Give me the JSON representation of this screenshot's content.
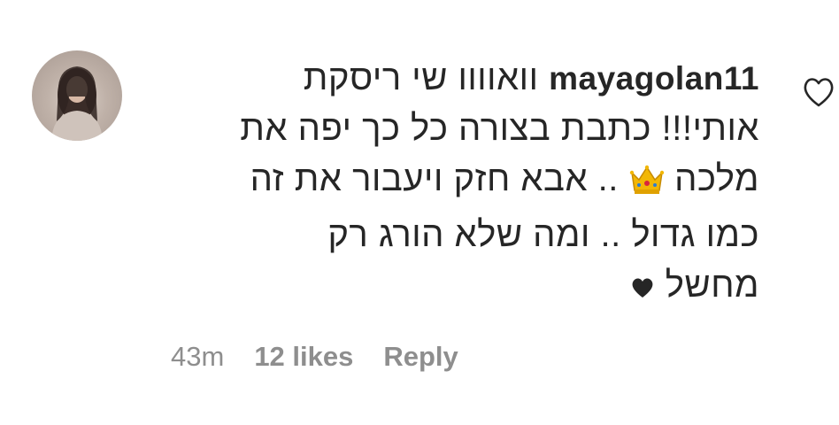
{
  "comment": {
    "username": "mayagolan11",
    "text_line1": "וואוווו שי ריסקת",
    "text_line2": "אותי!!! כתבת בצורה כל כך יפה את",
    "text_line3_a": "מלכה",
    "text_line3_b": ".. אבא חזק ויעבור את זה",
    "text_line4": "כמו גדול .. ומה שלא הורג רק",
    "text_line5": "מחשל",
    "crown_emoji_icon": "crown-icon",
    "heart_emoji_icon": "black-heart-icon"
  },
  "meta": {
    "time": "43m",
    "likes": "12 likes",
    "reply": "Reply"
  },
  "like_button_icon": "heart-outline-icon",
  "colors": {
    "text": "#262626",
    "meta": "#8e8e8e",
    "crown": "#f2b705"
  }
}
